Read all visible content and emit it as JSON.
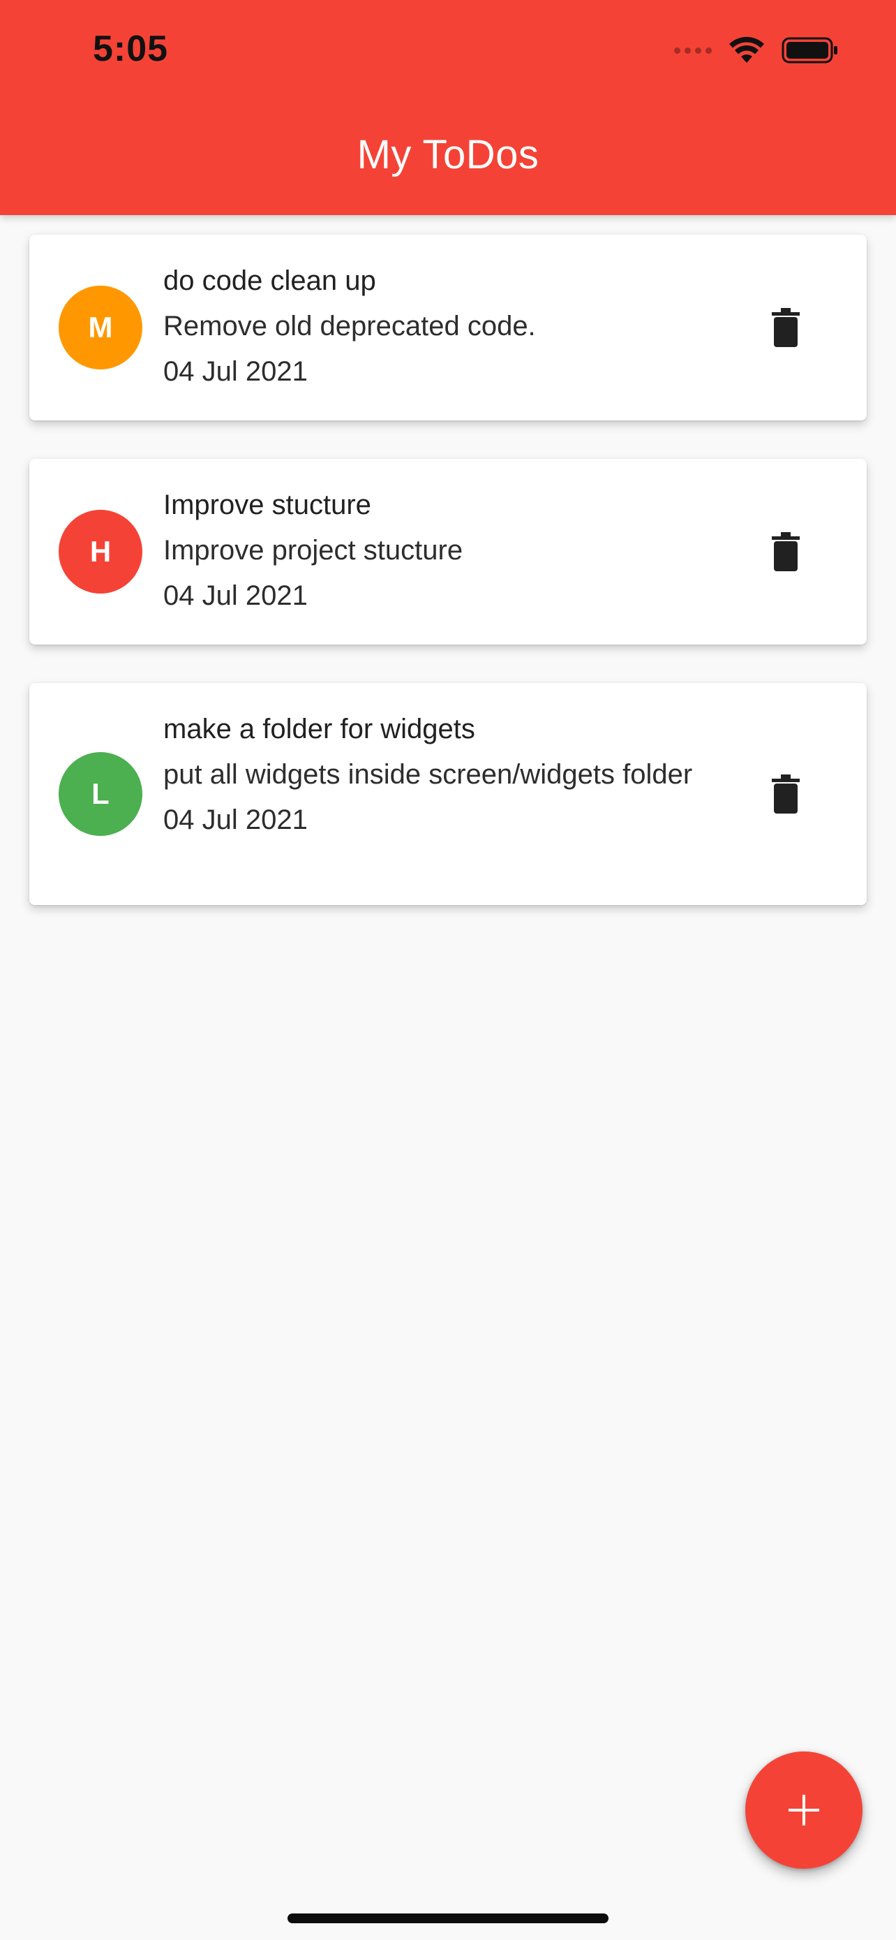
{
  "status_bar": {
    "time": "5:05",
    "icons": [
      "cellular-signal-icon",
      "wifi-icon",
      "battery-icon"
    ]
  },
  "appbar": {
    "title": "My ToDos",
    "color": "#f44336"
  },
  "todos": [
    {
      "avatar_letter": "M",
      "avatar_color": "#ff9800",
      "title": "do code clean up",
      "description": "Remove old deprecated code.",
      "date": "04 Jul 2021"
    },
    {
      "avatar_letter": "H",
      "avatar_color": "#f44336",
      "title": "Improve stucture",
      "description": "Improve project stucture",
      "date": "04 Jul 2021"
    },
    {
      "avatar_letter": "L",
      "avatar_color": "#4caf50",
      "title": "make a folder for widgets",
      "description": "put all widgets inside screen/widgets folder",
      "date": "04 Jul 2021"
    }
  ],
  "actions": {
    "delete_icon": "trash-icon",
    "fab_icon": "plus-icon",
    "fab_color": "#f44336"
  }
}
